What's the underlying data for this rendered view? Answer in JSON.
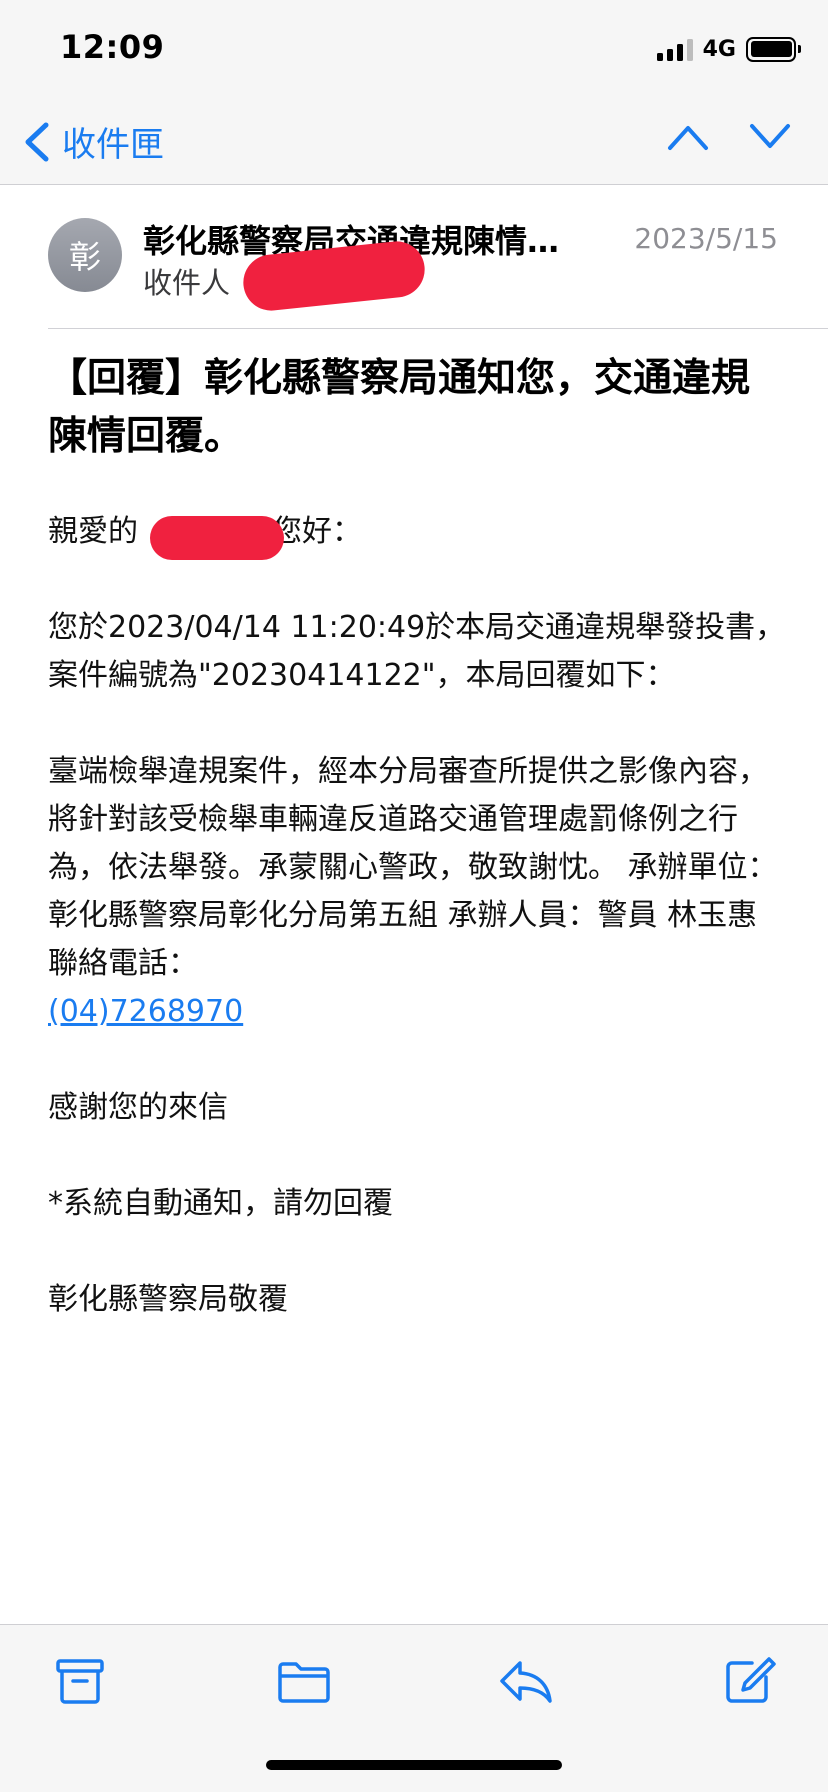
{
  "status_bar": {
    "time": "12:09",
    "network": "4G"
  },
  "nav": {
    "back_label": "收件匣"
  },
  "email": {
    "avatar_letter": "彰",
    "sender": "彰化縣警察局交通違規陳情…",
    "date": "2023/5/15",
    "recipient_label": "收件人",
    "subject": "【回覆】彰化縣警察局通知您，交通違規陳情回覆。",
    "greeting_prefix": "親愛的",
    "greeting_suffix": "您好：",
    "para1": "您於2023/04/14 11:20:49於本局交通違規舉發投書，案件編號為\"20230414122\"，本局回覆如下：",
    "para2": "臺端檢舉違規案件，經本分局審查所提供之影像內容，將針對該受檢舉車輛違反道路交通管理處罰條例之行為，依法舉發。承蒙關心警政，敬致謝忱。 承辦單位：彰化縣警察局彰化分局第五組 承辦人員：警員 林玉惠 聯絡電話：",
    "phone": "(04)7268970",
    "para3": "感謝您的來信",
    "para4": "*系統自動通知，請勿回覆",
    "para5": "彰化縣警察局敬覆"
  },
  "colors": {
    "accent": "#1a7cf0",
    "redaction": "#f0213f"
  },
  "toolbar": {
    "icons": [
      "archive-icon",
      "folder-icon",
      "reply-icon",
      "compose-icon"
    ]
  }
}
